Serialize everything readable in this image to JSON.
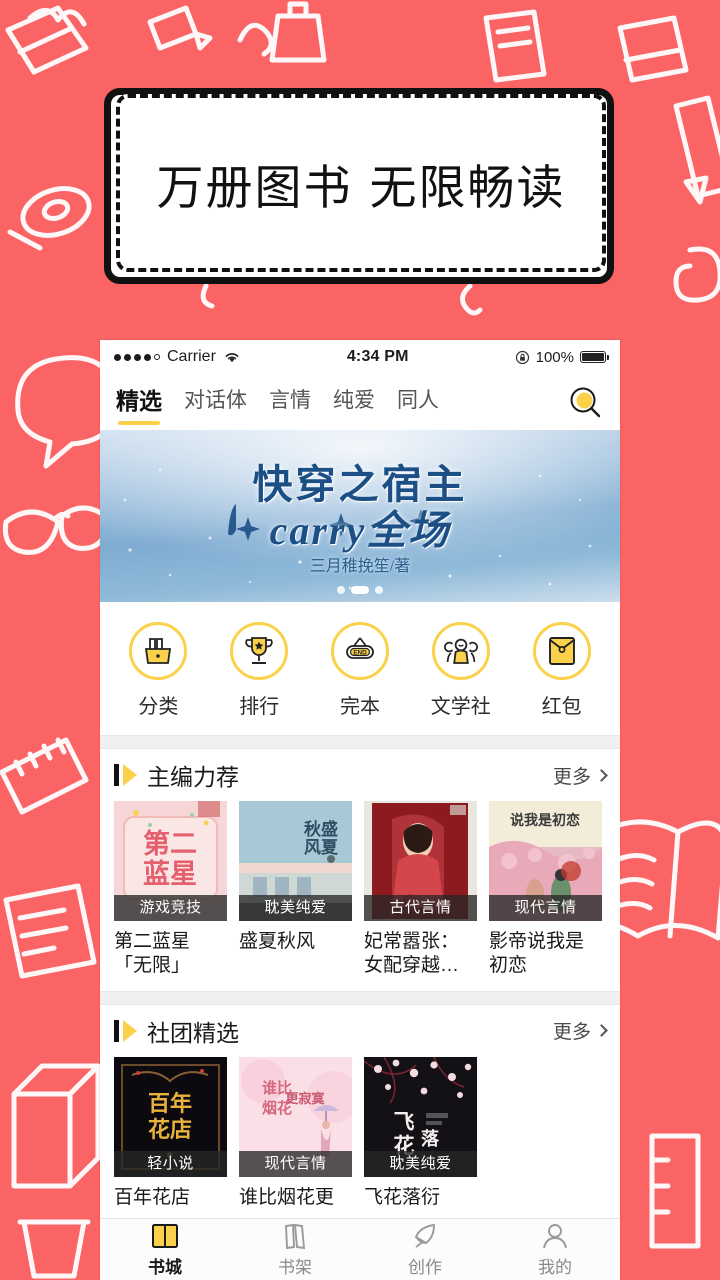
{
  "theme": {
    "background_color": "#fa6464",
    "accent_yellow": "#fbd14b",
    "text_dark": "#1a1a1a"
  },
  "promo": {
    "text": "万册图书  无限畅读"
  },
  "status_bar": {
    "carrier": "Carrier",
    "time": "4:34 PM",
    "battery_percent": "100%"
  },
  "nav_tabs": {
    "items": [
      {
        "label": "精选",
        "active": true
      },
      {
        "label": "对话体",
        "active": false
      },
      {
        "label": "言情",
        "active": false
      },
      {
        "label": "纯爱",
        "active": false
      },
      {
        "label": "同人",
        "active": false
      }
    ],
    "search_icon": "search-icon"
  },
  "banner": {
    "title": "快穿之宿主",
    "subtitle": "carry全场",
    "author": "三月稚挽笙/著",
    "page_count": 3,
    "active_page": 2
  },
  "quick_links": [
    {
      "label": "分类",
      "icon": "category-bag-icon"
    },
    {
      "label": "排行",
      "icon": "trophy-icon"
    },
    {
      "label": "完本",
      "icon": "end-sign-icon"
    },
    {
      "label": "文学社",
      "icon": "community-people-icon"
    },
    {
      "label": "红包",
      "icon": "red-envelope-icon"
    }
  ],
  "sections": [
    {
      "title": "主编力荐",
      "more_label": "更多",
      "books": [
        {
          "title": "第二蓝星「无限」",
          "tag": "游戏竞技",
          "cover": "pink-star"
        },
        {
          "title": "盛夏秋风",
          "tag": "耽美纯爱",
          "cover": "blue-school"
        },
        {
          "title": "妃常嚣张：女配穿越…",
          "tag": "古代言情",
          "cover": "red-ancient"
        },
        {
          "title": "影帝说我是初恋",
          "tag": "现代言情",
          "cover": "cream-romance"
        }
      ]
    },
    {
      "title": "社团精选",
      "more_label": "更多",
      "books": [
        {
          "title": "百年花店",
          "tag": "轻小说",
          "cover": "black-gold"
        },
        {
          "title": "谁比烟花更",
          "tag": "现代言情",
          "cover": "pink-umbrella"
        },
        {
          "title": "飞花落衍",
          "tag": "耽美纯爱",
          "cover": "dark-blossom"
        }
      ]
    }
  ],
  "tabbar": [
    {
      "label": "书城",
      "icon": "book-open-icon",
      "active": true
    },
    {
      "label": "书架",
      "icon": "bookshelf-icon",
      "active": false
    },
    {
      "label": "创作",
      "icon": "quill-pen-icon",
      "active": false
    },
    {
      "label": "我的",
      "icon": "user-person-icon",
      "active": false
    }
  ]
}
